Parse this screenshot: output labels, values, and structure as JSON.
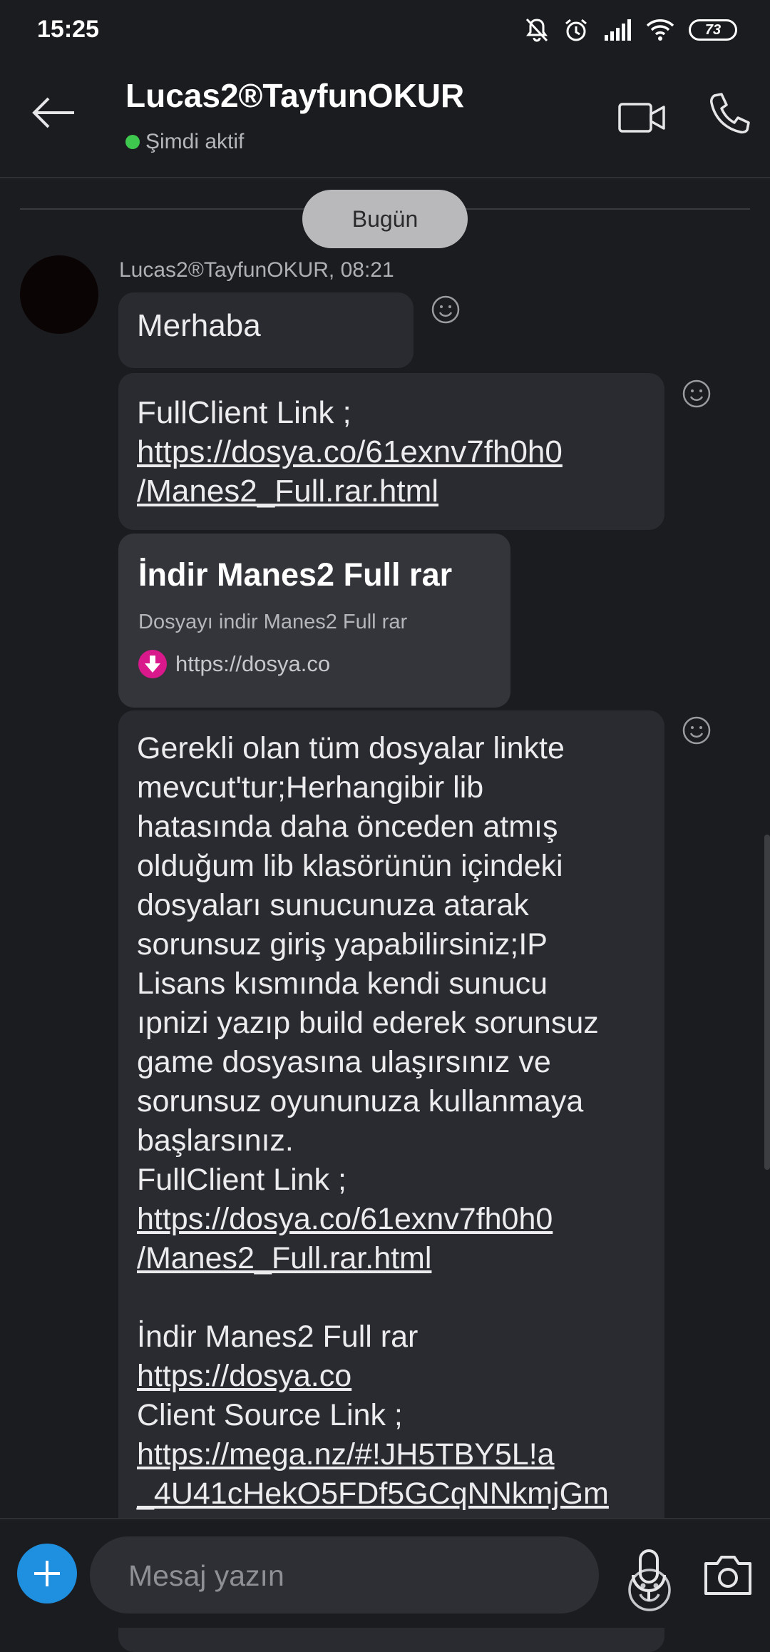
{
  "status_bar": {
    "time": "15:25",
    "battery": "73",
    "icons": [
      "mute-bell-icon",
      "alarm-icon",
      "signal-icon",
      "wifi-icon",
      "battery-icon"
    ]
  },
  "header": {
    "contact_name": "Lucas2®TayfunOKUR",
    "presence": "Şimdi aktif",
    "presence_color": "#3ec94e",
    "icons": [
      "back-arrow-icon",
      "video-call-icon",
      "phone-call-icon"
    ]
  },
  "conversation": {
    "day_label": "Bugün",
    "sender_meta": "Lucas2®TayfunOKUR, 08:21",
    "messages": {
      "m1": {
        "text": "Merhaba"
      },
      "m2": {
        "label": "FullClient Link ;",
        "link_line1": "https://dosya.co/61exnv7fh0h0",
        "link_line2": "/Manes2_Full.rar.html"
      },
      "preview": {
        "title": "İndir Manes2 Full rar",
        "description": "Dosyayı indir Manes2 Full rar",
        "site": "https://dosya.co"
      },
      "m4": {
        "lines": [
          "Gerekli olan tüm dosyalar linkte",
          "mevcut'tur;Herhangibir lib",
          "hatasında daha önceden atmış",
          "olduğum lib klasörünün içindeki",
          "dosyaları sunucunuza atarak",
          "sorunsuz giriş yapabilirsiniz;IP",
          "Lisans kısmında kendi sunucu",
          "ıpnizi yazıp build ederek sorunsuz",
          "game dosyasına ulaşırsınız ve",
          "sorunsuz oyununuza kullanmaya",
          "başlarsınız."
        ],
        "label": "FullClient Link ;",
        "link_line1": "https://dosya.co/61exnv7fh0h0",
        "link_line2": "/Manes2_Full.rar.html",
        "preview_title": "İndir Manes2 Full rar",
        "preview_link": "https://dosya.co",
        "source_label": "Client Source Link ;",
        "source_line1": "https://mega.nz/#!JH5TBY5L!a",
        "source_line2": "_4U41cHekO5FDf5GCqNNkmjGm"
      }
    }
  },
  "composer": {
    "placeholder": "Mesaj yazın",
    "accent": "#1f8fe0",
    "icons": [
      "plus-icon",
      "emoji-icon",
      "microphone-icon",
      "camera-icon"
    ]
  }
}
